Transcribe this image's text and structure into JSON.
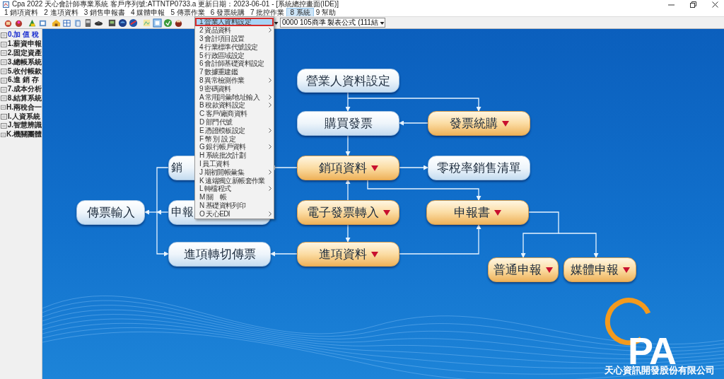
{
  "window": {
    "title": "Cpa 2022 天心會計師專業系統  客戶序列號:ATTNTP0733.a  更新日期：2023-06-01 - [系統總控畫面(IDE)]"
  },
  "menu_bar": [
    {
      "label": "1 銷項資料",
      "selected": false
    },
    {
      "label": "2 進項資料",
      "selected": false
    },
    {
      "label": "3 銷售申報書",
      "selected": false
    },
    {
      "label": "4 媒體申報",
      "selected": false
    },
    {
      "label": "5 傳票作業",
      "selected": false
    },
    {
      "label": "6 發票統購",
      "selected": false
    },
    {
      "label": "7 批控作業",
      "selected": false
    },
    {
      "label": "8 系統",
      "selected": true
    },
    {
      "label": "9 幫助",
      "selected": false
    }
  ],
  "toolbar": {
    "combo_value": "0000  105商準 製表公式 (111結"
  },
  "sidebar": {
    "items": [
      {
        "label": "0.加 值 稅",
        "selected": true
      },
      {
        "label": "1.薪資申報",
        "selected": false
      },
      {
        "label": "2.固定資產",
        "selected": false
      },
      {
        "label": "3.總帳系統",
        "selected": false
      },
      {
        "label": "5.收付帳款",
        "selected": false
      },
      {
        "label": "6.進 銷 存",
        "selected": false
      },
      {
        "label": "7.成本分析",
        "selected": false
      },
      {
        "label": "8.結算系統",
        "selected": false
      },
      {
        "label": "H.兩稅合一",
        "selected": false
      },
      {
        "label": "I.人資系統",
        "selected": false
      },
      {
        "label": "J.智慧辨識",
        "selected": false
      },
      {
        "label": "K.機關團體",
        "selected": false
      }
    ]
  },
  "system_menu": {
    "items": [
      {
        "label": "1 營業人資料設定",
        "submenu": false,
        "selected": true
      },
      {
        "label": "2 資品資料",
        "submenu": true,
        "selected": false
      },
      {
        "label": "3 會計項目設置",
        "submenu": false,
        "selected": false
      },
      {
        "label": "4 行業標準代號設定",
        "submenu": false,
        "selected": false
      },
      {
        "label": "5 行政區域設定",
        "submenu": false,
        "selected": false
      },
      {
        "label": "6 會計師基礎資料設定",
        "submenu": false,
        "selected": false
      },
      {
        "label": "7 數據重建鑑",
        "submenu": false,
        "selected": false
      },
      {
        "label": "8 異常檢測作業",
        "submenu": true,
        "selected": false
      },
      {
        "label": "9 密碼資料",
        "submenu": false,
        "selected": false
      },
      {
        "label": "A 常用詞彙/地址輸入",
        "submenu": true,
        "selected": false
      },
      {
        "label": "B 稅款資料設定",
        "submenu": true,
        "selected": false
      },
      {
        "label": "C 客戶/廠商資料",
        "submenu": false,
        "selected": false
      },
      {
        "label": "D 部門代號",
        "submenu": false,
        "selected": false
      },
      {
        "label": "E 憑證模板設定",
        "submenu": true,
        "selected": false
      },
      {
        "label": "F 幣 別 設 定",
        "submenu": false,
        "selected": false
      },
      {
        "label": "G 銀行帳戶資料",
        "submenu": true,
        "selected": false
      },
      {
        "label": "H 系統批次計劃",
        "submenu": false,
        "selected": false
      },
      {
        "label": "I 員工資料",
        "submenu": false,
        "selected": false
      },
      {
        "label": "J 期初開帳彙集",
        "submenu": true,
        "selected": false
      },
      {
        "label": "K 遠端獨立新帳套作業",
        "submenu": false,
        "selected": false
      },
      {
        "label": "L 轉檔程式",
        "submenu": true,
        "selected": false
      },
      {
        "label": "M 關　帳",
        "submenu": false,
        "selected": false
      },
      {
        "label": "N 基礎資料列印",
        "submenu": false,
        "selected": false
      },
      {
        "label": "O 天心EDI",
        "submenu": true,
        "selected": false
      }
    ]
  },
  "flow": {
    "nodes": [
      {
        "label": "營業人資料設定",
        "kind": "plain"
      },
      {
        "label": "購買發票",
        "kind": "plain"
      },
      {
        "label": "發票統購",
        "kind": "dropdown"
      },
      {
        "label": "銷",
        "kind": "plain",
        "cut": true
      },
      {
        "label": "銷項資料",
        "kind": "dropdown"
      },
      {
        "label": "零稅率銷售清單",
        "kind": "plain"
      },
      {
        "label": "傳票輸入",
        "kind": "plain"
      },
      {
        "label": "申報",
        "kind": "plain",
        "cut": true
      },
      {
        "label": "電子發票轉入",
        "kind": "dropdown"
      },
      {
        "label": "申報書",
        "kind": "dropdown"
      },
      {
        "label": "進項轉切傳票",
        "kind": "plain"
      },
      {
        "label": "進項資料",
        "kind": "dropdown"
      },
      {
        "label": "普通申報",
        "kind": "dropdown"
      },
      {
        "label": "媒體申報",
        "kind": "dropdown"
      }
    ]
  },
  "logo": {
    "mark": "PA",
    "company": "天心資訊開發股份有限公司"
  }
}
